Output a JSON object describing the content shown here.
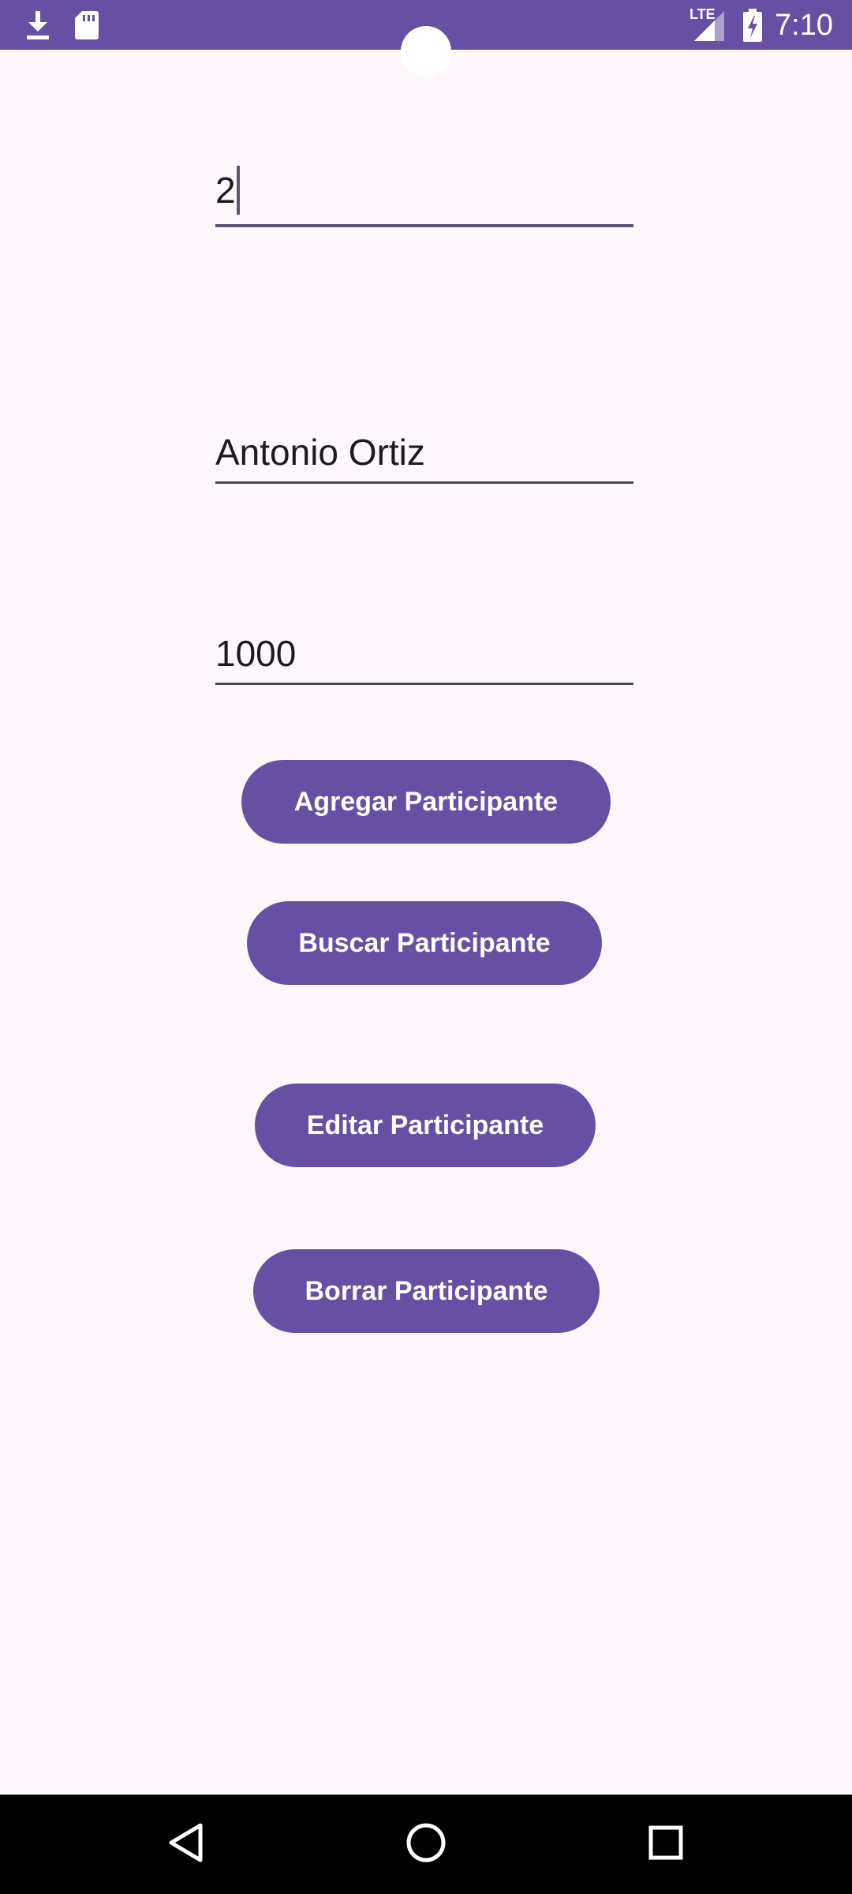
{
  "status_bar": {
    "time": "7:10",
    "network_label": "LTE",
    "left_icons": [
      "download-icon",
      "sd-card-icon"
    ],
    "right_icons": [
      "lte-signal-icon",
      "battery-charging-icon"
    ],
    "color": "#6750A4"
  },
  "form": {
    "id_field": {
      "value": "2",
      "focused": true
    },
    "name_field": {
      "value": "Antonio Ortiz"
    },
    "amount_field": {
      "value": "1000"
    }
  },
  "buttons": {
    "add_label": "Agregar Participante",
    "search_label": "Buscar Participante",
    "edit_label": "Editar Participante",
    "delete_label": "Borrar Participante"
  },
  "nav_bar": {
    "icons": [
      "back-icon",
      "home-icon",
      "recents-icon"
    ]
  },
  "colors": {
    "accent": "#6750A4",
    "background": "#FEF7FC",
    "nav_background": "#000000"
  }
}
